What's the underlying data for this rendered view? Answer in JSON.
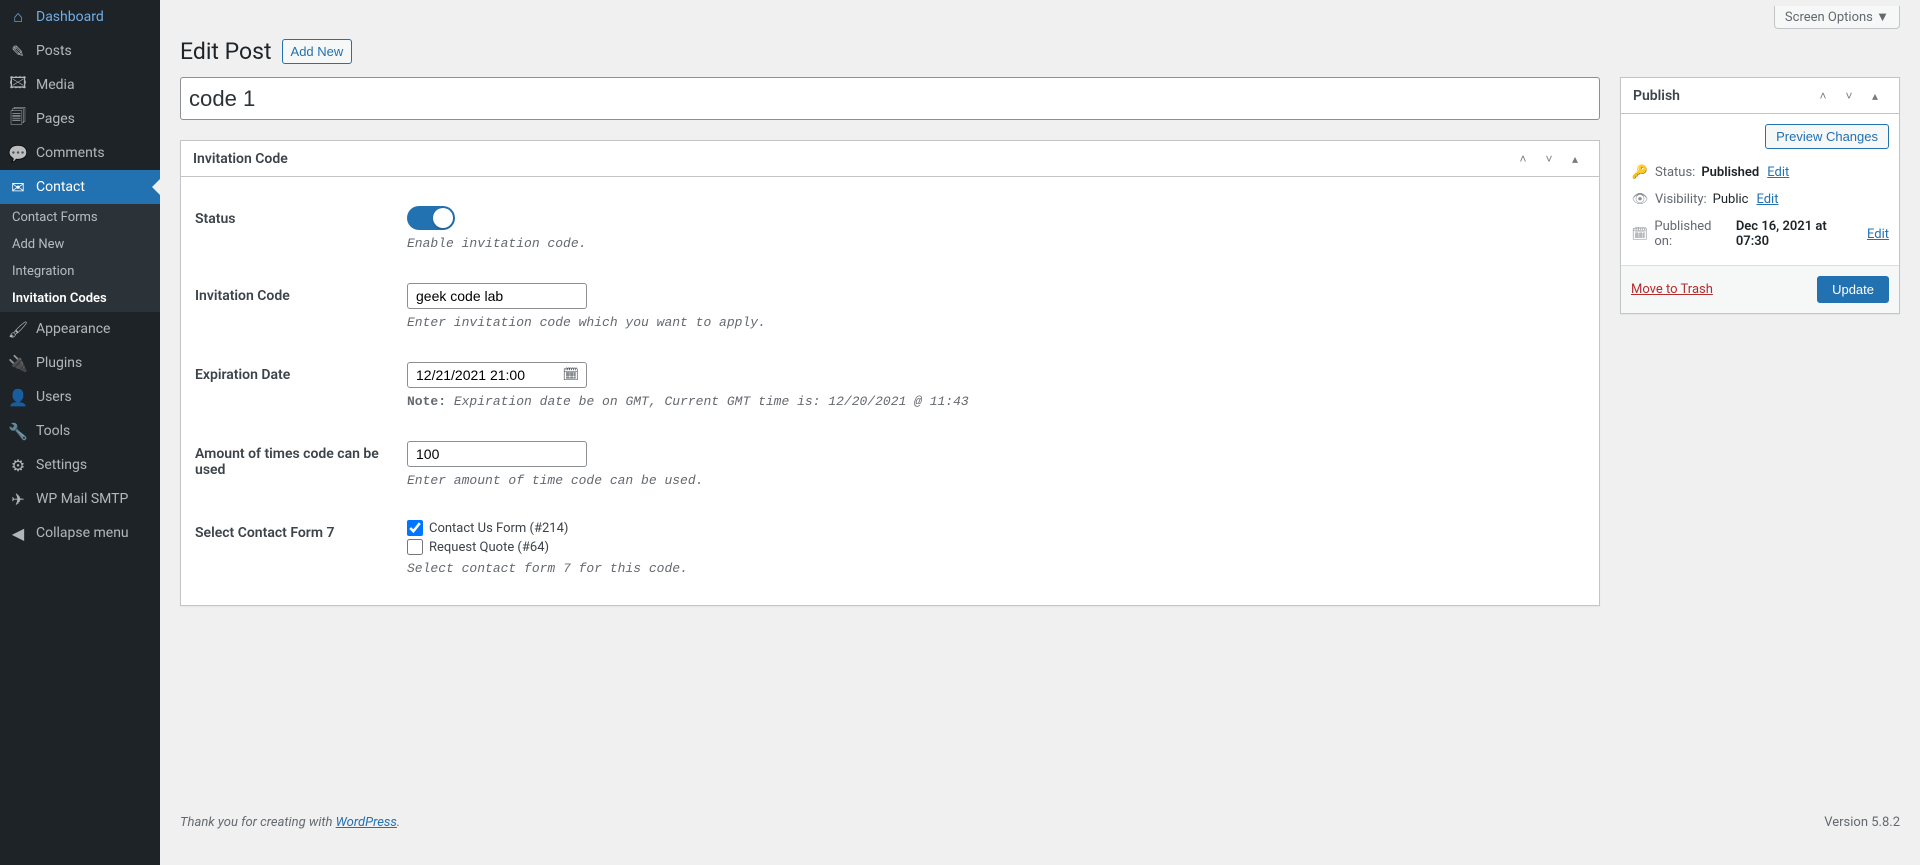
{
  "topbar": {
    "screen_options": "Screen Options"
  },
  "header": {
    "title": "Edit Post",
    "add_new": "Add New"
  },
  "post": {
    "title": "code 1"
  },
  "sidebar": {
    "items": [
      {
        "label": "Dashboard"
      },
      {
        "label": "Posts"
      },
      {
        "label": "Media"
      },
      {
        "label": "Pages"
      },
      {
        "label": "Comments"
      },
      {
        "label": "Contact"
      },
      {
        "label": "Appearance"
      },
      {
        "label": "Plugins"
      },
      {
        "label": "Users"
      },
      {
        "label": "Tools"
      },
      {
        "label": "Settings"
      },
      {
        "label": "WP Mail SMTP"
      },
      {
        "label": "Collapse menu"
      }
    ],
    "sub": [
      {
        "label": "Contact Forms"
      },
      {
        "label": "Add New"
      },
      {
        "label": "Integration"
      },
      {
        "label": "Invitation Codes"
      }
    ]
  },
  "metabox": {
    "title": "Invitation Code",
    "status_label": "Status",
    "status_help": "Enable invitation code.",
    "code_label": "Invitation Code",
    "code_value": "geek code lab",
    "code_help": "Enter invitation code which you want to apply.",
    "expire_label": "Expiration Date",
    "expire_value": "12/21/2021 21:00",
    "expire_note_label": "Note:",
    "expire_note": "Expiration date be on GMT, Current GMT time is: 12/20/2021 @ 11:43",
    "amount_label": "Amount of times code can be used",
    "amount_value": "100",
    "amount_help": "Enter amount of time code can be used.",
    "cf7_label": "Select Contact Form 7",
    "cf7_opt1": "Contact Us Form (#214)",
    "cf7_opt2": "Request Quote (#64)",
    "cf7_help": "Select contact form 7 for this code."
  },
  "publish": {
    "title": "Publish",
    "preview": "Preview Changes",
    "status_label": "Status:",
    "status_value": "Published",
    "visibility_label": "Visibility:",
    "visibility_value": "Public",
    "published_label": "Published on:",
    "published_value": "Dec 16, 2021 at 07:30",
    "edit": "Edit",
    "trash": "Move to Trash",
    "update": "Update"
  },
  "footer": {
    "thanks_pre": "Thank you for creating with ",
    "wp": "WordPress",
    "version": "Version 5.8.2"
  }
}
